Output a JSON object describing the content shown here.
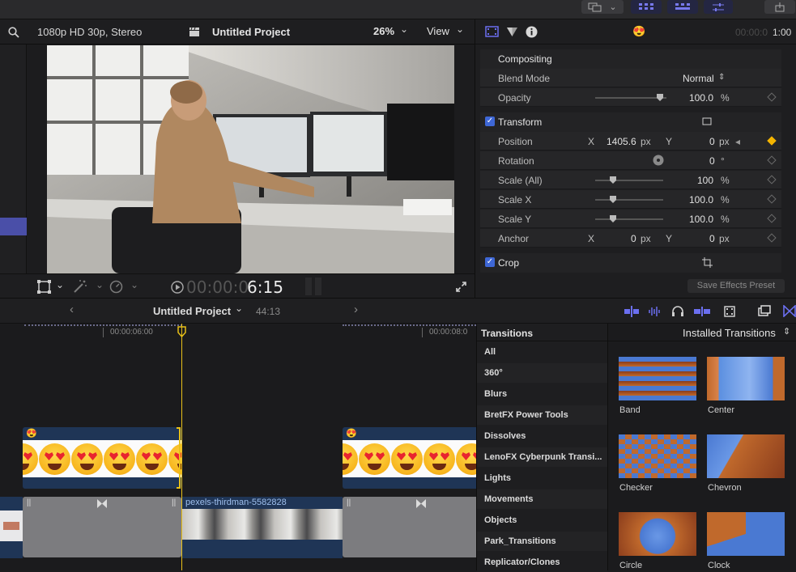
{
  "viewer": {
    "format": "1080p HD 30p, Stereo",
    "project_title": "Untitled Project",
    "zoom": "26%",
    "view_label": "View",
    "timecode_dim": "00:00:0",
    "timecode_bright": "6:15"
  },
  "inspector": {
    "emoji": "😍",
    "timecode_dim": "00:00:0",
    "timecode_bright": "1:00",
    "compositing": "Compositing",
    "blend_mode_label": "Blend Mode",
    "blend_mode_value": "Normal",
    "opacity_label": "Opacity",
    "opacity_value": "100.0",
    "opacity_unit": "%",
    "transform": "Transform",
    "position_label": "Position",
    "pos_x_axis": "X",
    "pos_x": "1405.6",
    "pos_x_unit": "px",
    "pos_y_axis": "Y",
    "pos_y": "0",
    "pos_y_unit": "px",
    "rotation_label": "Rotation",
    "rotation_value": "0",
    "rotation_unit": "°",
    "scale_all_label": "Scale (All)",
    "scale_all_value": "100",
    "scale_all_unit": "%",
    "scale_x_label": "Scale X",
    "scale_x_value": "100.0",
    "scale_x_unit": "%",
    "scale_y_label": "Scale Y",
    "scale_y_value": "100.0",
    "scale_y_unit": "%",
    "anchor_label": "Anchor",
    "anchor_x_axis": "X",
    "anchor_x": "0",
    "anchor_x_unit": "px",
    "anchor_y_axis": "Y",
    "anchor_y": "0",
    "anchor_y_unit": "px",
    "crop": "Crop",
    "save_preset": "Save Effects Preset"
  },
  "timeline": {
    "project": "Untitled Project",
    "duration": "44:13",
    "tc1": "00:00:06:00",
    "tc2": "00:00:08:0",
    "clip_name": "pexels-thirdman-5582828",
    "title_emoji": "😍"
  },
  "transitions": {
    "header": "Transitions",
    "installed": "Installed Transitions",
    "categories": [
      "All",
      "360°",
      "Blurs",
      "BretFX Power Tools",
      "Dissolves",
      "LenoFX Cyberpunk Transi...",
      "Lights",
      "Movements",
      "Objects",
      "Park_Transitions",
      "Replicator/Clones"
    ],
    "items": [
      "Band",
      "Center",
      "Checker",
      "Chevron",
      "Circle",
      "Clock"
    ]
  },
  "colors": {
    "accent": "#3e67d6",
    "playhead": "#e8c018",
    "keyframe": "#f4b400"
  }
}
